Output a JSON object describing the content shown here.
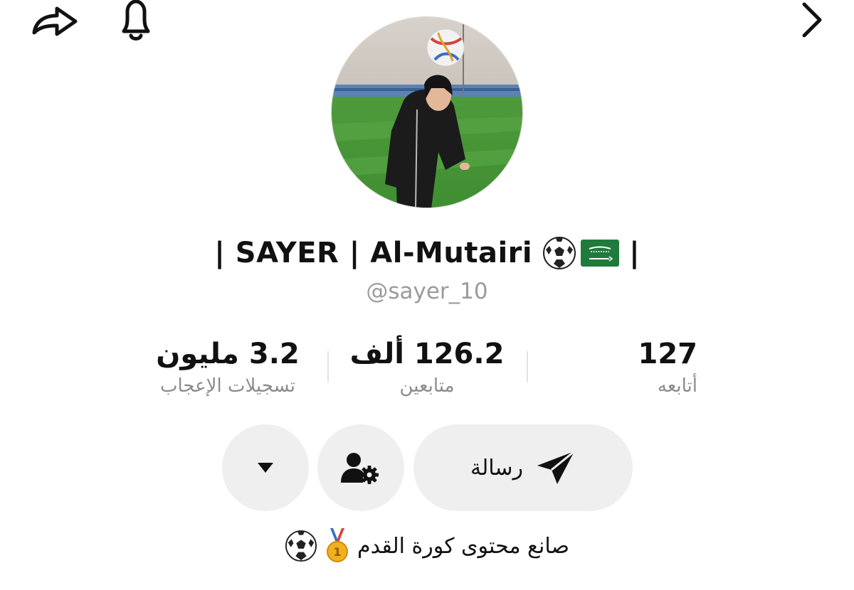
{
  "header": {
    "share_icon": "share-icon",
    "bell_icon": "bell-icon",
    "back_icon": "chevron-right-icon"
  },
  "profile": {
    "display_name": "| SAYER | Al-Mutairi",
    "display_name_suffix": "|",
    "name_emojis": [
      "soccer-ball-icon",
      "saudi-flag-icon"
    ],
    "username": "@sayer_10"
  },
  "stats": {
    "following": {
      "value": "127",
      "label": "أتابعه"
    },
    "followers": {
      "value": "126.2 ألف",
      "label": "متابعين"
    },
    "likes": {
      "value": "3.2 مليون",
      "label": "تسجيلات الإعجاب"
    }
  },
  "actions": {
    "message_label": "رسالة",
    "message_icon": "send-icon",
    "profile_settings_icon": "user-settings-icon",
    "dropdown_icon": "caret-down-icon"
  },
  "bio": {
    "text": "صانع محتوى كورة القدم",
    "emojis": [
      "first-place-medal-icon",
      "soccer-ball-icon"
    ]
  },
  "colors": {
    "text_primary": "#111111",
    "text_secondary": "#8a8b91",
    "username_gray": "#9b9b9e",
    "button_bg": "#efefef",
    "divider": "#e3e3e4",
    "flag_green": "#1f7a3b"
  }
}
